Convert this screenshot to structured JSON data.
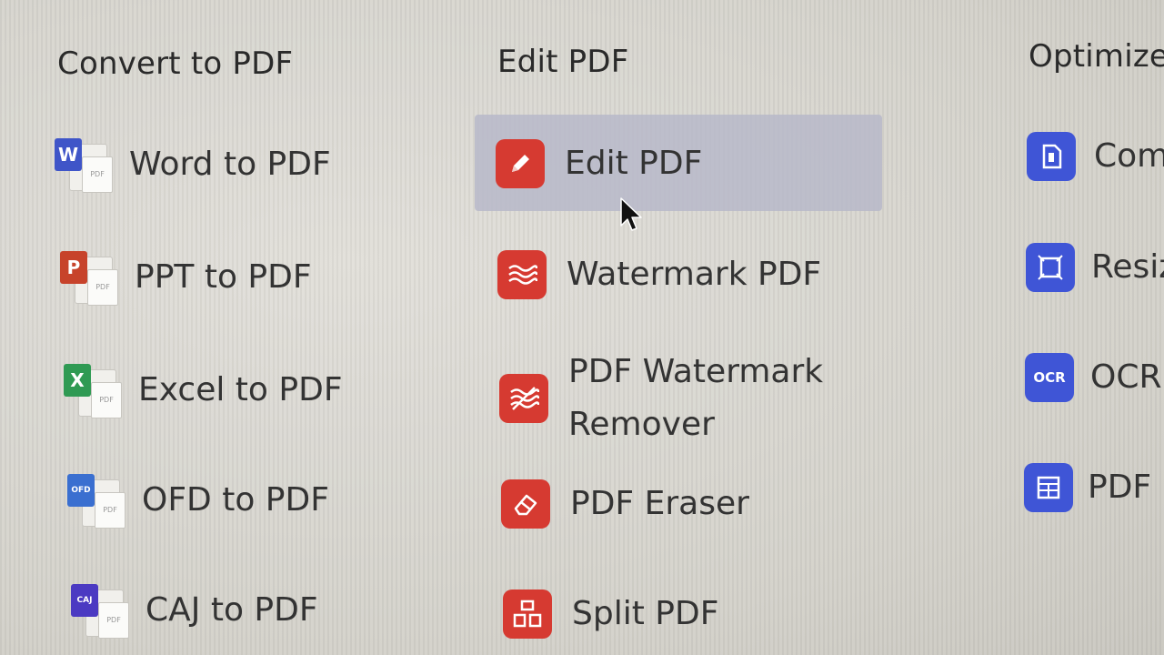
{
  "columns": {
    "convert": {
      "header": "Convert to PDF",
      "items": [
        {
          "label": "Word to PDF",
          "icon": "word-file-icon",
          "color": "#3f55c8",
          "badge": "W"
        },
        {
          "label": "PPT to PDF",
          "icon": "ppt-file-icon",
          "color": "#c7432b",
          "badge": "P"
        },
        {
          "label": "Excel to PDF",
          "icon": "excel-file-icon",
          "color": "#2f9a53",
          "badge": "X"
        },
        {
          "label": "OFD to PDF",
          "icon": "ofd-file-icon",
          "color": "#3a6fd0",
          "badge": "OFD"
        },
        {
          "label": "CAJ to PDF",
          "icon": "caj-file-icon",
          "color": "#4b3ac2",
          "badge": "CAJ"
        }
      ]
    },
    "edit": {
      "header": "Edit PDF",
      "items": [
        {
          "label": "Edit PDF",
          "icon": "pencil-icon",
          "selected": true
        },
        {
          "label": "Watermark PDF",
          "icon": "watermark-icon"
        },
        {
          "label_line1": "PDF Watermark",
          "label_line2": "Remover",
          "icon": "watermark-remover-icon"
        },
        {
          "label": "PDF Eraser",
          "icon": "eraser-icon"
        },
        {
          "label": "Split PDF",
          "icon": "split-icon"
        }
      ]
    },
    "optimize": {
      "header": "Optimize",
      "items": [
        {
          "label": "Com",
          "icon": "compress-icon"
        },
        {
          "label": "Resiz",
          "icon": "resize-icon"
        },
        {
          "label": "OCR",
          "icon": "ocr-icon",
          "icon_text": "OCR"
        },
        {
          "label": "PDF",
          "icon": "pdf-table-icon"
        }
      ]
    }
  },
  "colors": {
    "tool_red": "#d63a31",
    "tool_blue": "#3f55d6",
    "selection": "#b7b8c9"
  }
}
